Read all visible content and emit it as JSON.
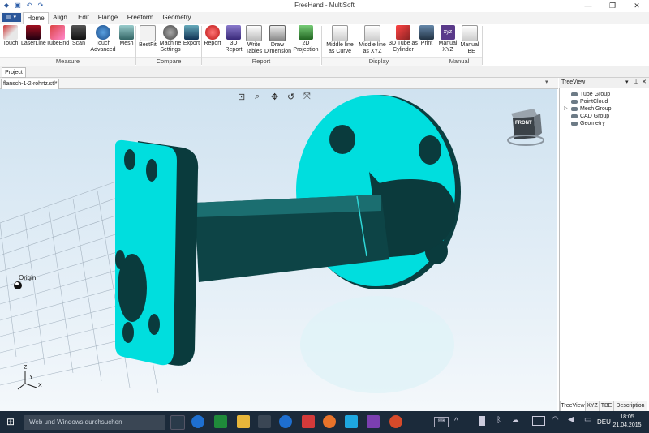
{
  "window": {
    "title": "FreeHand - MultiSoft"
  },
  "menu": {
    "app_button": "▤ ▾",
    "tabs": [
      "Home",
      "Align",
      "Edit",
      "Flange",
      "Freeform",
      "Geometry"
    ]
  },
  "ribbon": {
    "measure": {
      "label": "Measure",
      "buttons": [
        "Touch",
        "LaserLine",
        "TubeEnd",
        "Scan",
        "Touch Advanced",
        "Mesh"
      ]
    },
    "compare": {
      "label": "Compare",
      "buttons": [
        "BestFit",
        "Machine Settings",
        "Export"
      ]
    },
    "report": {
      "label": "Report",
      "buttons": [
        "Report",
        "3D Report",
        "Write Tables",
        "Draw Dimension",
        "2D Projection"
      ]
    },
    "display": {
      "label": "Display",
      "buttons": [
        "Middle line as Curve",
        "Middle line as XYZ",
        "3D Tube as Cylinder",
        "Print"
      ]
    },
    "manual": {
      "label": "Manual",
      "buttons": [
        "Manual XYZ",
        "Manual TBE"
      ]
    }
  },
  "project": {
    "tab": "Project",
    "document_tab": "flansch-1-2-rohrtz.stl*"
  },
  "viewport": {
    "origin_label": "Origin",
    "axes": {
      "z": "Z",
      "y": "Y",
      "x": "X"
    },
    "viewcube_label": "FRONT",
    "toolbar_icons": [
      "zoom-window-icon",
      "zoom-icon",
      "pan-icon",
      "rotate-icon",
      "fit-icon"
    ]
  },
  "treeview": {
    "title": "TreeView",
    "items": [
      "Tube Group",
      "PointCloud",
      "Mesh Group",
      "CAD Group",
      "Geometry"
    ],
    "bottom_tabs": [
      "TreeView",
      "XYZ",
      "TBE",
      "Description"
    ]
  },
  "taskbar": {
    "search_placeholder": "Web und Windows durchsuchen",
    "language": "DEU",
    "time": "18:05",
    "date": "21.04.2015"
  },
  "colors": {
    "model_cyan": "#00e5e5",
    "model_dark": "#0a3b3d",
    "accent_blue": "#2b579a",
    "taskbar": "#1b2a3a"
  }
}
